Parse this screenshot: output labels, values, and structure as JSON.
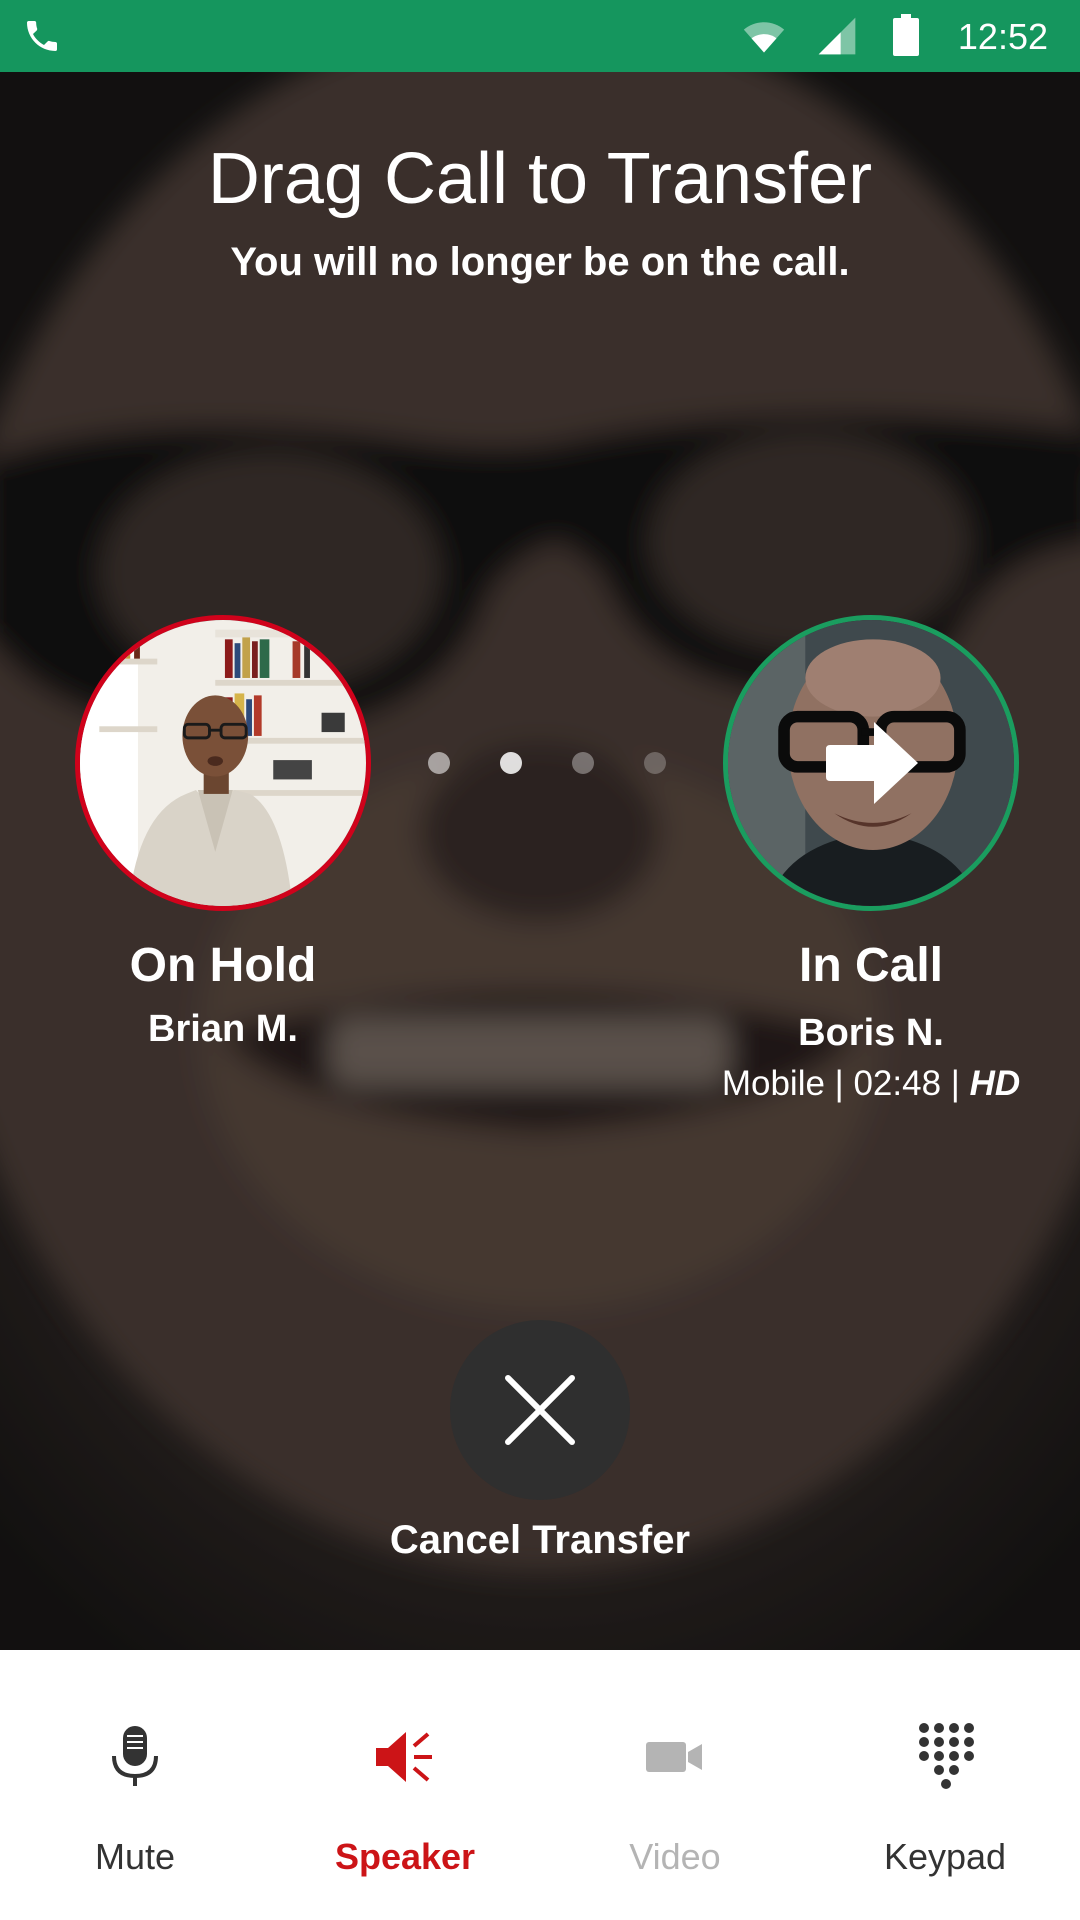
{
  "status_bar": {
    "time": "12:52",
    "icons": [
      "phone-icon",
      "wifi-icon",
      "signal-icon",
      "battery-icon"
    ],
    "color": "#15965e"
  },
  "header": {
    "title": "Drag Call to Transfer",
    "subtitle": "You will no longer be on the call."
  },
  "calls": {
    "on_hold": {
      "status": "On Hold",
      "name": "Brian M.",
      "ring_color": "#d0021b"
    },
    "in_call": {
      "status": "In Call",
      "name": "Boris N.",
      "meta": "Mobile | 02:48 | ",
      "quality": "HD",
      "ring_color": "#1a9d5f"
    }
  },
  "pager": {
    "dots": 4
  },
  "cancel": {
    "label": "Cancel Transfer",
    "icon": "close-icon"
  },
  "toolbar": {
    "items": [
      {
        "label": "Mute",
        "icon": "microphone-icon",
        "color": "#333333"
      },
      {
        "label": "Speaker",
        "icon": "speaker-icon",
        "color": "#cc1417",
        "active": true
      },
      {
        "label": "Video",
        "icon": "video-camera-icon",
        "color": "#b4b4b4",
        "disabled": true
      },
      {
        "label": "Keypad",
        "icon": "keypad-icon",
        "color": "#333333"
      }
    ]
  }
}
